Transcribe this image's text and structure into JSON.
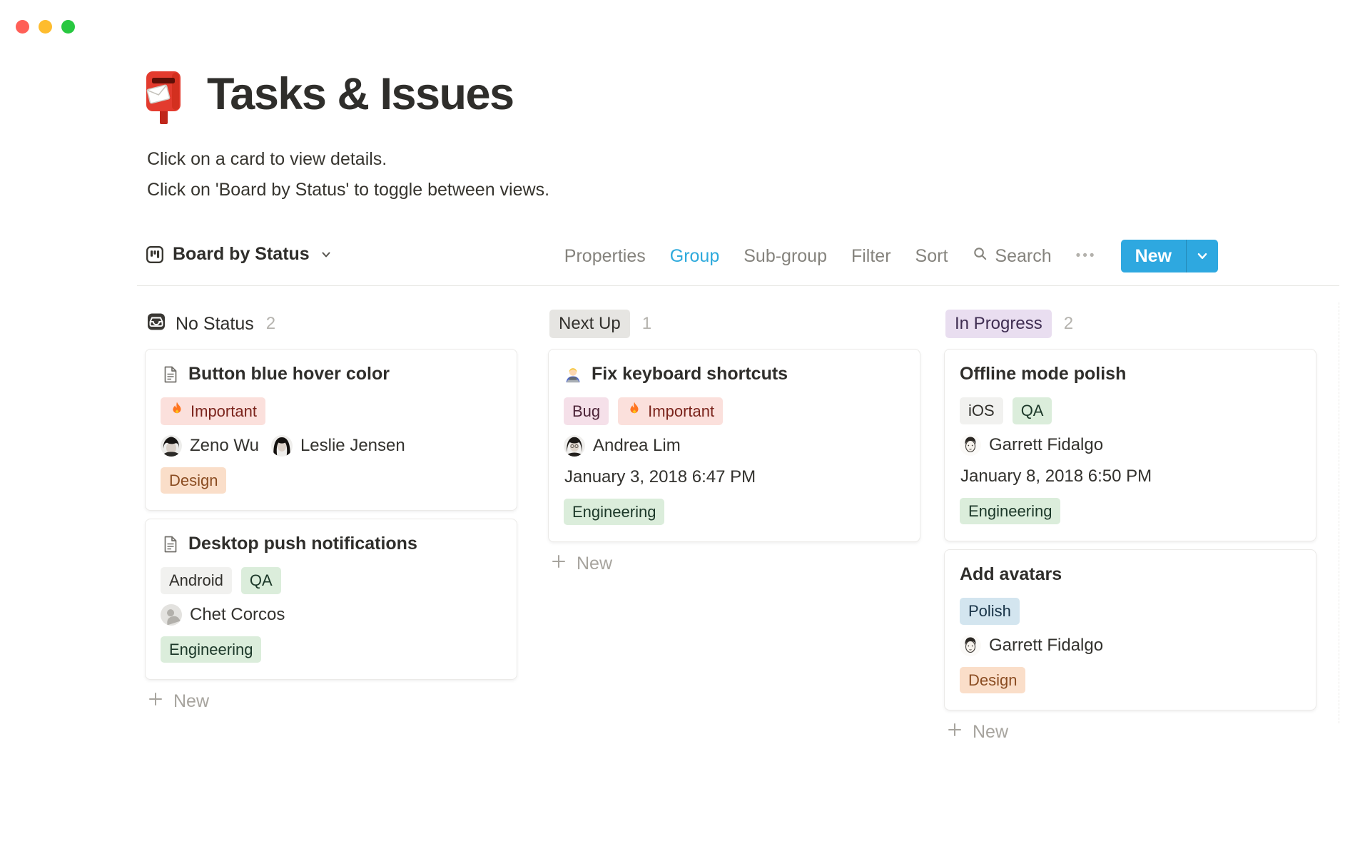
{
  "window": {
    "traffic_lights": [
      "close",
      "minimize",
      "zoom"
    ]
  },
  "page": {
    "icon": "postbox-icon",
    "title": "Tasks & Issues",
    "description_lines": [
      "Click on a card to view details.",
      "Click on 'Board by Status' to toggle between views."
    ]
  },
  "toolbar": {
    "view_label": "Board by Status",
    "items": [
      "Properties",
      "Group",
      "Sub-group",
      "Filter",
      "Sort"
    ],
    "active_item": "Group",
    "search_label": "Search",
    "more_label": "•••",
    "new_label": "New"
  },
  "board": {
    "columns": [
      {
        "header": {
          "icon": "inbox-icon",
          "label": "No Status",
          "count": "2",
          "style": "plain"
        },
        "cards": [
          {
            "icon": "page-icon",
            "title": "Button blue hover color",
            "tags_top": [
              {
                "label": "Important",
                "color": "red",
                "icon": "fire-icon"
              }
            ],
            "people": [
              {
                "name": "Zeno Wu",
                "avatar": "zeno-wu"
              },
              {
                "name": "Leslie Jensen",
                "avatar": "leslie-jensen"
              }
            ],
            "tags_bottom": [
              {
                "label": "Design",
                "color": "orange"
              }
            ]
          },
          {
            "icon": "page-icon",
            "title": "Desktop push notifications",
            "tags_top": [
              {
                "label": "Android",
                "color": "gray"
              },
              {
                "label": "QA",
                "color": "green"
              }
            ],
            "people": [
              {
                "name": "Chet Corcos",
                "avatar": "default-avatar"
              }
            ],
            "tags_bottom": [
              {
                "label": "Engineering",
                "color": "green"
              }
            ]
          }
        ],
        "add_card_label": "New"
      },
      {
        "header": {
          "label": "Next Up",
          "count": "1",
          "style": "badge-gray"
        },
        "cards": [
          {
            "icon": "technologist-icon",
            "title": "Fix keyboard shortcuts",
            "tags_top": [
              {
                "label": "Bug",
                "color": "pink"
              },
              {
                "label": "Important",
                "color": "red",
                "icon": "fire-icon"
              }
            ],
            "people": [
              {
                "name": "Andrea Lim",
                "avatar": "andrea-lim"
              }
            ],
            "date": "January 3, 2018 6:47 PM",
            "tags_bottom": [
              {
                "label": "Engineering",
                "color": "green"
              }
            ]
          }
        ],
        "add_card_label": "New"
      },
      {
        "header": {
          "label": "In Progress",
          "count": "2",
          "style": "badge-purple"
        },
        "cards": [
          {
            "title": "Offline mode polish",
            "tags_top": [
              {
                "label": "iOS",
                "color": "gray"
              },
              {
                "label": "QA",
                "color": "green"
              }
            ],
            "people": [
              {
                "name": "Garrett Fidalgo",
                "avatar": "garrett-fidalgo"
              }
            ],
            "date": "January 8, 2018 6:50 PM",
            "tags_bottom": [
              {
                "label": "Engineering",
                "color": "green"
              }
            ]
          },
          {
            "title": "Add avatars",
            "tags_top": [
              {
                "label": "Polish",
                "color": "blue"
              }
            ],
            "people": [
              {
                "name": "Garrett Fidalgo",
                "avatar": "garrett-fidalgo"
              }
            ],
            "tags_bottom": [
              {
                "label": "Design",
                "color": "orange"
              }
            ]
          }
        ],
        "add_card_label": "New"
      }
    ]
  },
  "palette": {
    "accent_blue": "#2eaadc",
    "traffic_red": "#ff5f57",
    "traffic_yellow": "#febc2e",
    "traffic_green": "#28c840",
    "tag_red_bg": "#fbe0dc",
    "tag_red_text": "#7b241c",
    "tag_orange_bg": "#fadec9",
    "tag_orange_text": "#8a4c21",
    "tag_gray_bg": "#f1f1ef",
    "tag_gray_text": "#32302c",
    "tag_green_bg": "#dbeddb",
    "tag_green_text": "#1c3829",
    "tag_pink_bg": "#f5e0e9",
    "tag_pink_text": "#4c2337",
    "tag_blue_bg": "#d3e5ef",
    "tag_blue_text": "#183347",
    "badge_gray_bg": "#e6e5e2",
    "badge_purple_bg": "#e9def0"
  }
}
